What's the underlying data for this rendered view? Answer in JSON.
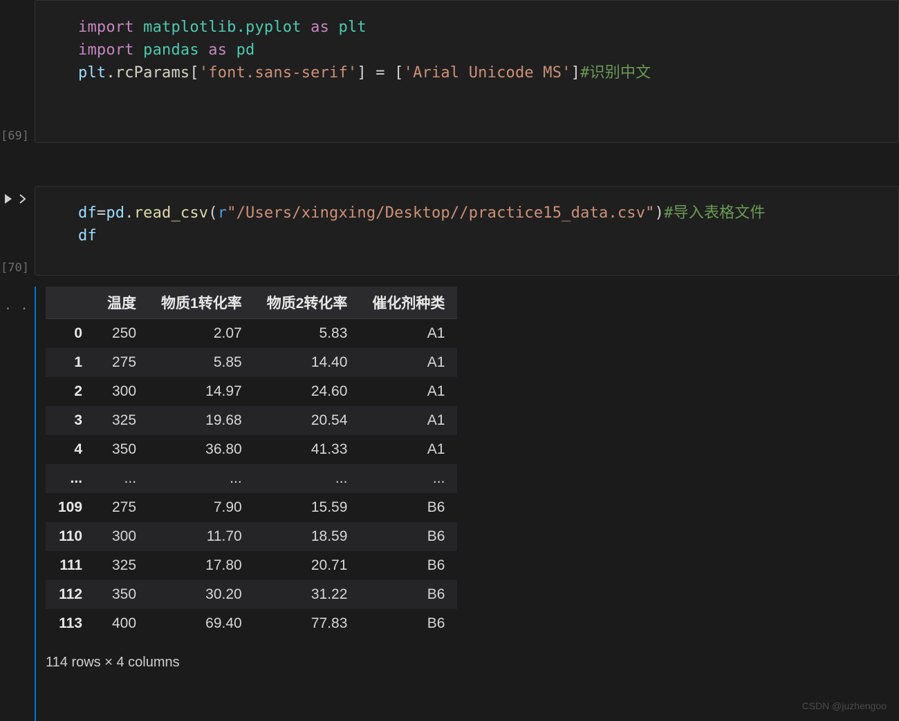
{
  "cell1": {
    "exec_label": "[69]",
    "line1_import": "import",
    "line1_module": "matplotlib.pyplot",
    "line1_as": "as",
    "line1_alias": "plt",
    "line2_import": "import",
    "line2_module": "pandas",
    "line2_as": "as",
    "line2_alias": "pd",
    "line3_obj": "plt",
    "line3_attr": ".rcParams",
    "line3_key": "'font.sans-serif'",
    "line3_val": "'Arial Unicode MS'",
    "line3_comment": "#识别中文"
  },
  "cell2": {
    "exec_label": "[70]",
    "line1_var": "df",
    "line1_mod": "pd",
    "line1_fn": "read_csv",
    "line1_rprefix": "r",
    "line1_path": "\"/Users/xingxing/Desktop//practice15_data.csv\"",
    "line1_comment": "#导入表格文件",
    "line2": "df"
  },
  "dataframe": {
    "headers": [
      "",
      "温度",
      "物质1转化率",
      "物质2转化率",
      "催化剂种类"
    ],
    "rows": [
      [
        "0",
        "250",
        "2.07",
        "5.83",
        "A1"
      ],
      [
        "1",
        "275",
        "5.85",
        "14.40",
        "A1"
      ],
      [
        "2",
        "300",
        "14.97",
        "24.60",
        "A1"
      ],
      [
        "3",
        "325",
        "19.68",
        "20.54",
        "A1"
      ],
      [
        "4",
        "350",
        "36.80",
        "41.33",
        "A1"
      ],
      [
        "...",
        "...",
        "...",
        "...",
        "..."
      ],
      [
        "109",
        "275",
        "7.90",
        "15.59",
        "B6"
      ],
      [
        "110",
        "300",
        "11.70",
        "18.59",
        "B6"
      ],
      [
        "111",
        "325",
        "17.80",
        "20.71",
        "B6"
      ],
      [
        "112",
        "350",
        "30.20",
        "31.22",
        "B6"
      ],
      [
        "113",
        "400",
        "69.40",
        "77.83",
        "B6"
      ]
    ],
    "shape_text": "114 rows × 4 columns"
  },
  "watermark": "CSDN @juzhengoo",
  "gutter_dots": "· ·"
}
